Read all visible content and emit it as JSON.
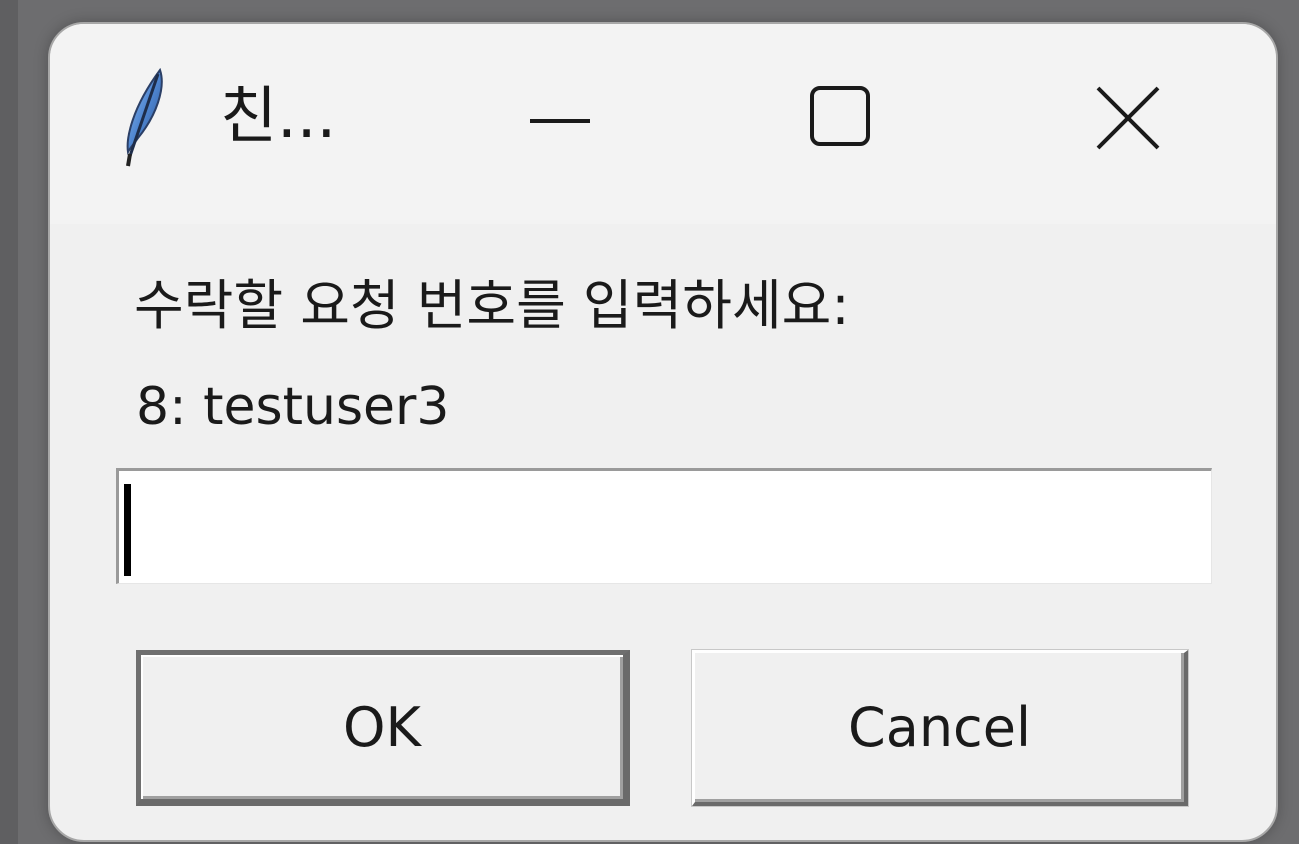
{
  "window": {
    "title": "친...",
    "minimize_icon": "minimize-icon",
    "maximize_icon": "maximize-icon",
    "close_icon": "close-icon",
    "app_icon": "feather-icon"
  },
  "dialog": {
    "prompt": "수락할 요청 번호를 입력하세요:",
    "prompt_detail": "8: testuser3",
    "entry_value": "",
    "ok_label": "OK",
    "cancel_label": "Cancel"
  },
  "colors": {
    "desktop": "#6d6d6f",
    "window_bg": "#f0f0f0",
    "entry_bg": "#ffffff"
  }
}
